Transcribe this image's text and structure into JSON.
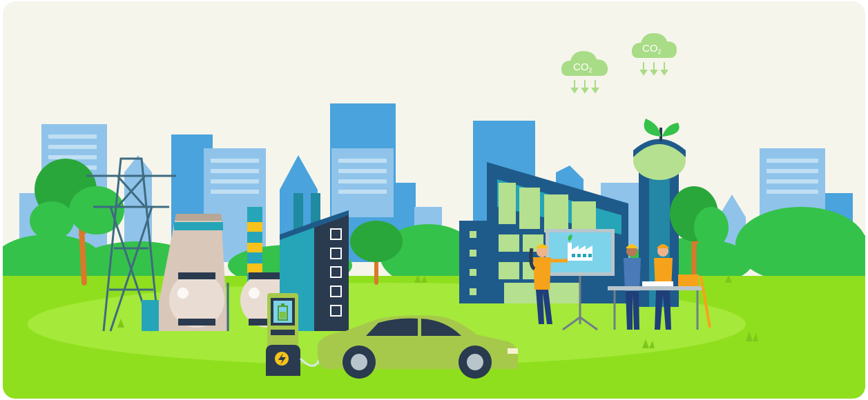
{
  "scene": {
    "co2_clouds": [
      {
        "label": "CO",
        "subscript": "2"
      },
      {
        "label": "CO",
        "subscript": "2"
      }
    ],
    "colors": {
      "sky": "#f6f5ec",
      "ground": "#8fdf1e",
      "ground_light": "#a5e93a",
      "bush": "#35c24a",
      "tree": "#2aa73a",
      "building_blue": "#4aa3dc",
      "building_light": "#8fc3ea",
      "dark_blue": "#1f5b8a",
      "teal": "#26a5b8",
      "car": "#a6c94b",
      "co2_cloud": "#a9dc86",
      "cooling_tower": "#d9c7b9"
    },
    "icons": [
      "co2-cloud-icon",
      "leaf-icon",
      "factory-icon",
      "lightning-icon",
      "battery-icon"
    ]
  }
}
